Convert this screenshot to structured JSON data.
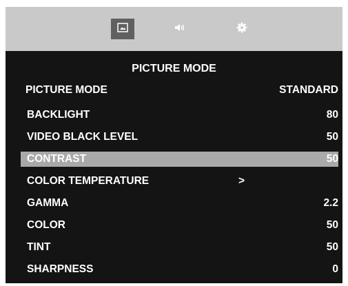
{
  "tabs": [
    {
      "id": "picture",
      "icon": "picture-icon",
      "selected": true
    },
    {
      "id": "sound",
      "icon": "speaker-icon",
      "selected": false
    },
    {
      "id": "setup",
      "icon": "gear-icon",
      "selected": false
    }
  ],
  "menu": {
    "title": "PICTURE MODE",
    "items": [
      {
        "label": "PICTURE MODE",
        "value": "STANDARD"
      },
      {
        "label": "BACKLIGHT",
        "value": "80"
      },
      {
        "label": "VIDEO BLACK LEVEL",
        "value": "50"
      },
      {
        "label": "CONTRAST",
        "value": "50",
        "highlighted": true
      },
      {
        "label": "COLOR TEMPERATURE",
        "value": ">"
      },
      {
        "label": "GAMMA",
        "value": "2.2"
      },
      {
        "label": "COLOR",
        "value": "50"
      },
      {
        "label": "TINT",
        "value": "50"
      },
      {
        "label": "SHARPNESS",
        "value": "0"
      }
    ]
  },
  "colors": {
    "topbar": "#c9c9c9",
    "menu_background": "#141414",
    "highlight": "#a9a9a9",
    "text": "#ffffff"
  }
}
